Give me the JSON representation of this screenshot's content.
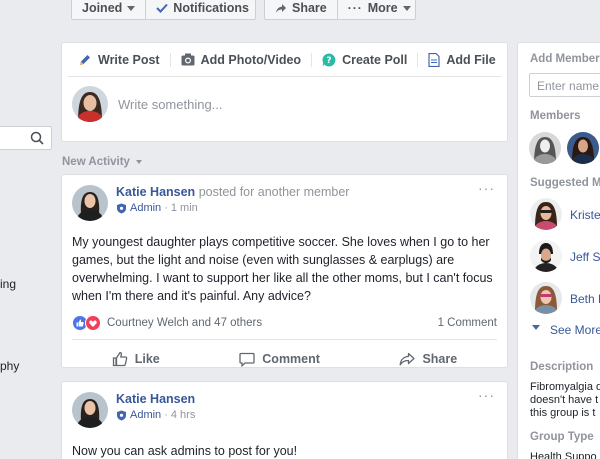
{
  "top_actions": {
    "joined_label": "Joined",
    "notifications_label": "Notifications",
    "share_label": "Share",
    "more_label": "More"
  },
  "left_nav": {
    "items": [
      "ing",
      "phy"
    ]
  },
  "composer": {
    "tabs": [
      {
        "label": "Write Post",
        "icon": "pencil-icon"
      },
      {
        "label": "Add Photo/Video",
        "icon": "camera-icon"
      },
      {
        "label": "Create Poll",
        "icon": "poll-icon"
      },
      {
        "label": "Add File",
        "icon": "file-icon"
      }
    ],
    "placeholder": "Write something..."
  },
  "feed": {
    "section_label": "New Activity"
  },
  "posts": [
    {
      "author": "Katie Hansen",
      "context": "posted for another member",
      "role": "Admin",
      "time": "1 min",
      "text": "My youngest daughter plays competitive soccer.  She loves when I go to her games, but the light and noise (even with sunglasses & earplugs) are overwhelming.  I want to support her like all the other moms, but I can't focus when I'm there and it's painful.  Any advice?",
      "reactions_text": "Courtney Welch and 47 others",
      "comments_text": "1 Comment",
      "actions": {
        "like": "Like",
        "comment": "Comment",
        "share": "Share"
      }
    },
    {
      "author": "Katie Hansen",
      "role": "Admin",
      "time": "4 hrs",
      "text": "Now you can ask admins to post for you!"
    }
  ],
  "sidebar": {
    "add_members_heading": "Add Member",
    "add_members_placeholder": "Enter name o",
    "members_heading": "Members",
    "suggested_heading": "Suggested M",
    "suggested": [
      "Kriste",
      "Jeff S",
      "Beth D"
    ],
    "see_more": "See More",
    "description_heading": "Description",
    "description_lines": [
      "Fibromyalgia d",
      "doesn't have t",
      "this group is t"
    ],
    "group_type_heading": "Group Type",
    "group_type_value": "Health Suppo"
  },
  "colors": {
    "link_blue": "#385898",
    "background": "#e9ebee",
    "like_blue": "#4a76e8",
    "love_red": "#f33e58"
  }
}
